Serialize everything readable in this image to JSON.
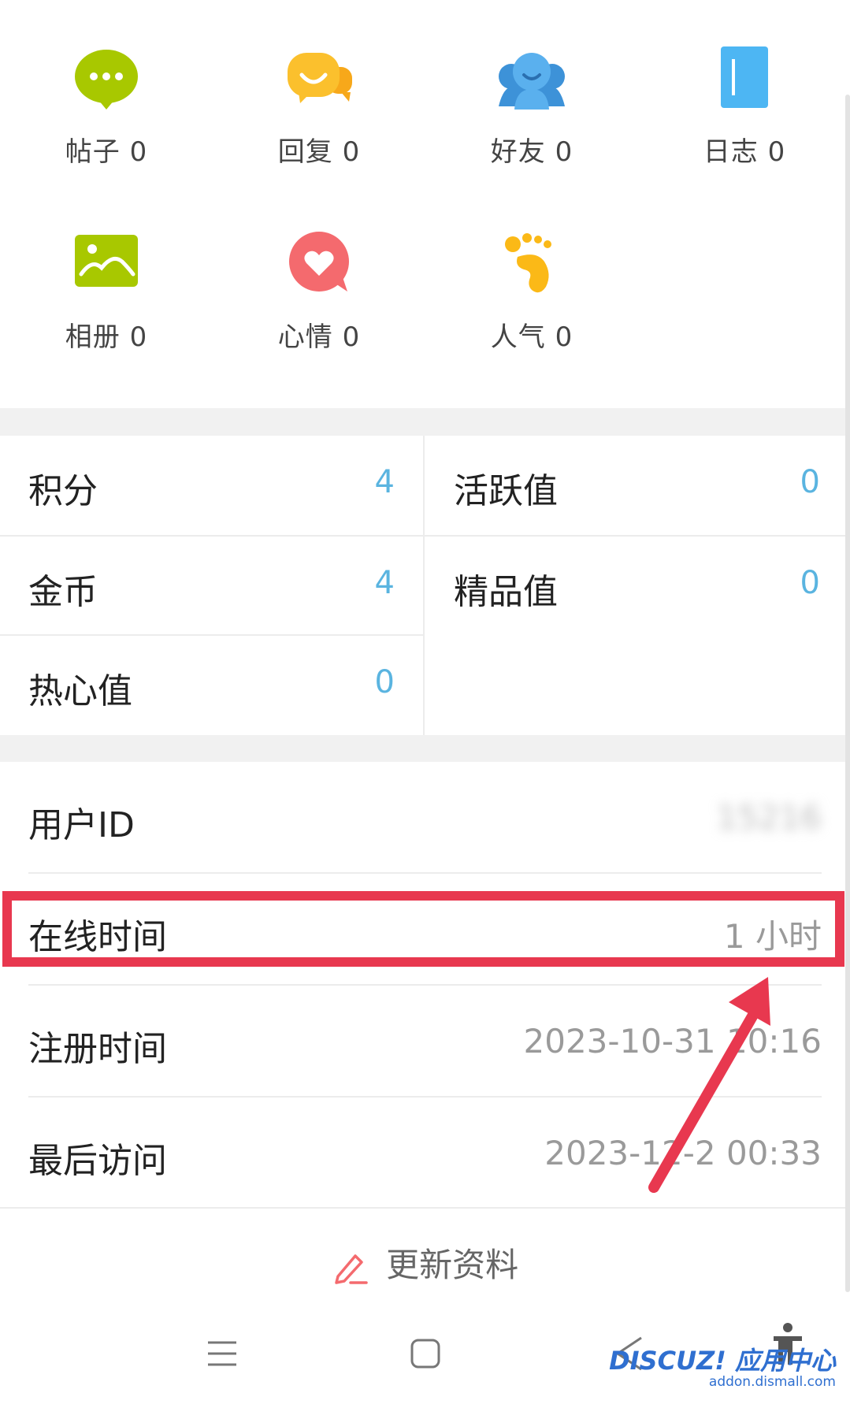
{
  "icons": [
    {
      "name": "posts",
      "label": "帖子 0",
      "color": "#a8c800"
    },
    {
      "name": "replies",
      "label": "回复 0",
      "color": "#fbbf17"
    },
    {
      "name": "friends",
      "label": "好友 0",
      "color": "#4fa7e9"
    },
    {
      "name": "blog",
      "label": "日志 0",
      "color": "#49b6f2"
    },
    {
      "name": "album",
      "label": "相册 0",
      "color": "#a8c800"
    },
    {
      "name": "mood",
      "label": "心情 0",
      "color": "#f46a6e"
    },
    {
      "name": "popularity",
      "label": "人气 0",
      "color": "#fbb917"
    }
  ],
  "stats": {
    "credits": {
      "label": "积分",
      "value": "4"
    },
    "activity": {
      "label": "活跃值",
      "value": "0"
    },
    "coins": {
      "label": "金币",
      "value": "4"
    },
    "quality": {
      "label": "精品值",
      "value": "0"
    },
    "enthusiasm": {
      "label": "热心值",
      "value": "0"
    }
  },
  "info": {
    "user_id": {
      "label": "用户ID",
      "value": "15216"
    },
    "online_time": {
      "label": "在线时间",
      "value": "1 小时"
    },
    "register_time": {
      "label": "注册时间",
      "value": "2023-10-31 10:16"
    },
    "last_visit": {
      "label": "最后访问",
      "value": "2023-12-2 00:33"
    }
  },
  "actions": {
    "update_profile": "更新资料"
  },
  "watermark": {
    "brand": "DISCUZ! 应用中心",
    "url": "addon.dismall.com"
  },
  "accent": {
    "highlight": "#e8384f",
    "value_blue": "#5ab4e0",
    "arrow": "#e8384f"
  }
}
